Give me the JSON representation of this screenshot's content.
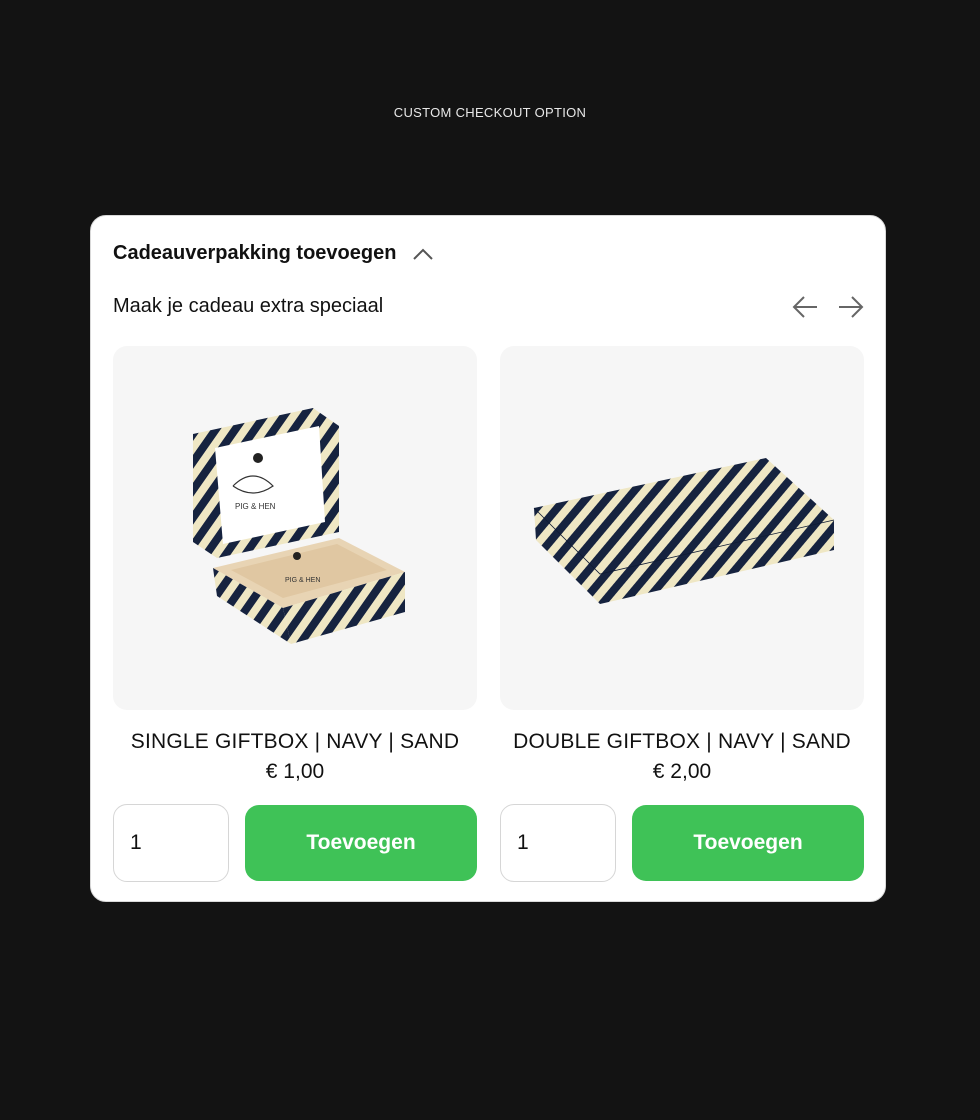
{
  "page": {
    "caption": "CUSTOM CHECKOUT OPTION"
  },
  "panel": {
    "title": "Cadeauverpakking toevoegen",
    "subtitle": "Maak je cadeau extra speciaal",
    "collapse_icon": "chevron-up-icon",
    "prev_icon": "arrow-left-icon",
    "next_icon": "arrow-right-icon"
  },
  "products": [
    {
      "name": "SINGLE GIFTBOX | NAVY | SAND",
      "price": "€ 1,00",
      "quantity": "1",
      "button_label": "Toevoegen"
    },
    {
      "name": "DOUBLE GIFTBOX | NAVY | SAND",
      "price": "€ 2,00",
      "quantity": "1",
      "button_label": "Toevoegen"
    }
  ],
  "colors": {
    "background": "#131313",
    "card": "#ffffff",
    "accent_green": "#3fc257",
    "stripe_navy": "#16233f",
    "stripe_sand": "#efe7c4"
  }
}
